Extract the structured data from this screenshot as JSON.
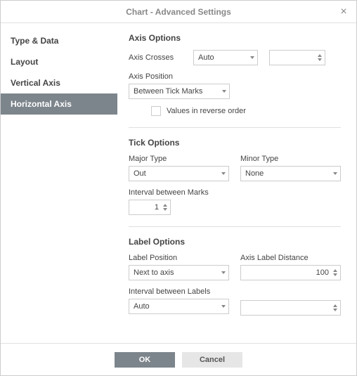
{
  "title": "Chart - Advanced Settings",
  "sidebar": {
    "items": [
      {
        "label": "Type & Data"
      },
      {
        "label": "Layout"
      },
      {
        "label": "Vertical Axis"
      },
      {
        "label": "Horizontal Axis"
      }
    ],
    "activeIndex": 3
  },
  "axisOptions": {
    "heading": "Axis Options",
    "crossesLabel": "Axis Crosses",
    "crossesValue": "Auto",
    "crossesNumber": "",
    "positionLabel": "Axis Position",
    "positionValue": "Between Tick Marks",
    "reverseLabel": "Values in reverse order"
  },
  "tickOptions": {
    "heading": "Tick Options",
    "majorLabel": "Major Type",
    "majorValue": "Out",
    "minorLabel": "Minor Type",
    "minorValue": "None",
    "intervalMarksLabel": "Interval between Marks",
    "intervalMarksValue": "1"
  },
  "labelOptions": {
    "heading": "Label Options",
    "positionLabel": "Label Position",
    "positionValue": "Next to axis",
    "distanceLabel": "Axis Label Distance",
    "distanceValue": "100",
    "intervalLabelsLabel": "Interval between Labels",
    "intervalLabelsValue": "Auto",
    "intervalLabelsNumber": ""
  },
  "footer": {
    "ok": "OK",
    "cancel": "Cancel"
  }
}
